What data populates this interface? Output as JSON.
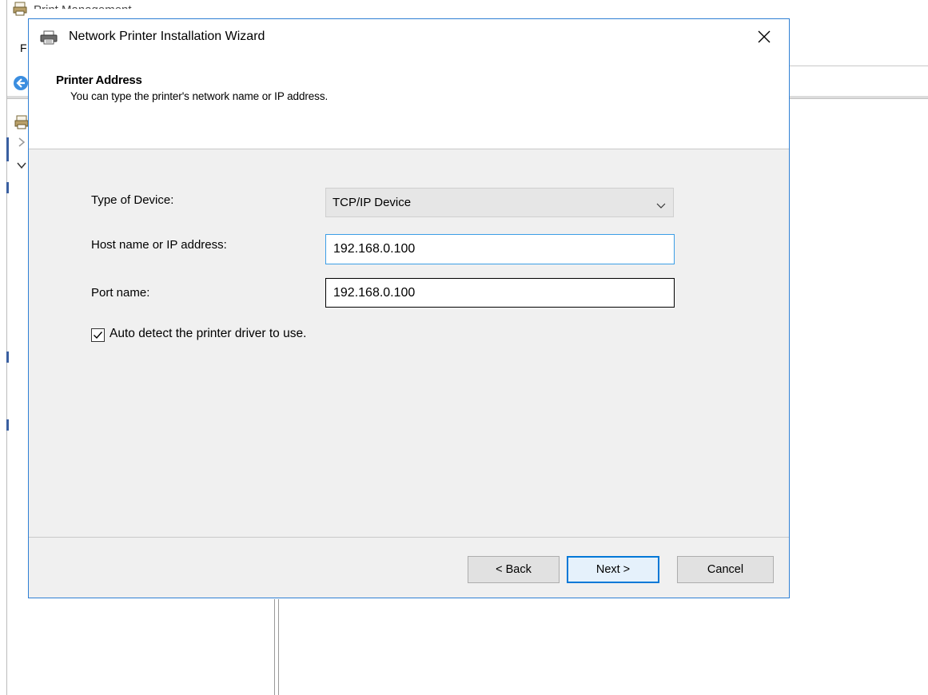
{
  "background_app": {
    "title": "Print Management",
    "menu_letter": "F"
  },
  "wizard": {
    "title": "Network Printer Installation Wizard",
    "header": {
      "title": "Printer Address",
      "subtitle": "You can type the printer's network name or IP address."
    },
    "type_of_device": {
      "label": "Type of Device:",
      "value": "TCP/IP Device"
    },
    "host": {
      "label": "Host name or IP address:",
      "value": "192.168.0.100"
    },
    "port": {
      "label": "Port name:",
      "value": "192.168.0.100"
    },
    "auto_detect": {
      "label": "Auto detect the printer driver to use.",
      "checked": true
    },
    "buttons": {
      "back": "< Back",
      "next": "Next >",
      "cancel": "Cancel"
    }
  },
  "colors": {
    "window_border": "#2f7fd4",
    "focus_border": "#3c9ee6",
    "default_button_border": "#0078d7",
    "dialog_background": "#f0f0f0"
  },
  "icons": [
    "printer-icon",
    "close-icon",
    "chevron-down-icon",
    "checkmark-icon",
    "back-arrow-icon",
    "print-management-icon"
  ]
}
